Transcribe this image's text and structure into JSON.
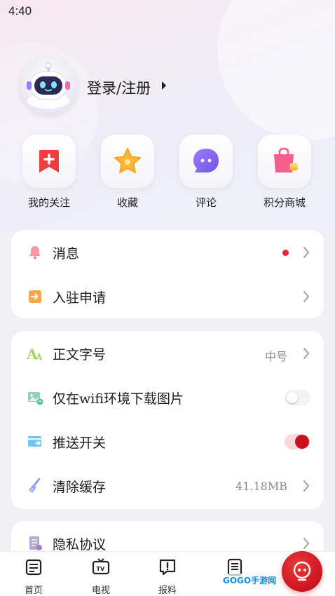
{
  "status_bar": {
    "time": "4:40"
  },
  "profile": {
    "login_label": "登录/注册"
  },
  "quick_actions": [
    {
      "label": "我的关注",
      "icon": "bookmark-plus-icon"
    },
    {
      "label": "收藏",
      "icon": "star-icon"
    },
    {
      "label": "评论",
      "icon": "comment-bubble-icon"
    },
    {
      "label": "积分商城",
      "icon": "shopping-bag-icon"
    }
  ],
  "group1": [
    {
      "label": "消息",
      "icon": "bell-icon",
      "has_dot": true
    },
    {
      "label": "入驻申请",
      "icon": "enter-icon"
    }
  ],
  "group2": [
    {
      "label": "正文字号",
      "icon": "font-size-icon",
      "value": "中号"
    },
    {
      "label": "仅在wifi环境下载图片",
      "icon": "image-wifi-icon",
      "toggle": false
    },
    {
      "label": "推送开关",
      "icon": "push-icon",
      "toggle": true
    },
    {
      "label": "清除缓存",
      "icon": "broom-icon",
      "value": "41.18MB"
    }
  ],
  "group3": [
    {
      "label": "隐私协议",
      "icon": "document-icon"
    }
  ],
  "tabbar": [
    {
      "label": "首页",
      "icon": "home-news-icon"
    },
    {
      "label": "电视",
      "icon": "tv-icon"
    },
    {
      "label": "报料",
      "icon": "report-icon"
    },
    {
      "label": "",
      "icon": "document-list-icon"
    }
  ],
  "watermark": "GOGO手游网",
  "colors": {
    "accent": "#c8111d",
    "background": "#f1f0f5"
  }
}
